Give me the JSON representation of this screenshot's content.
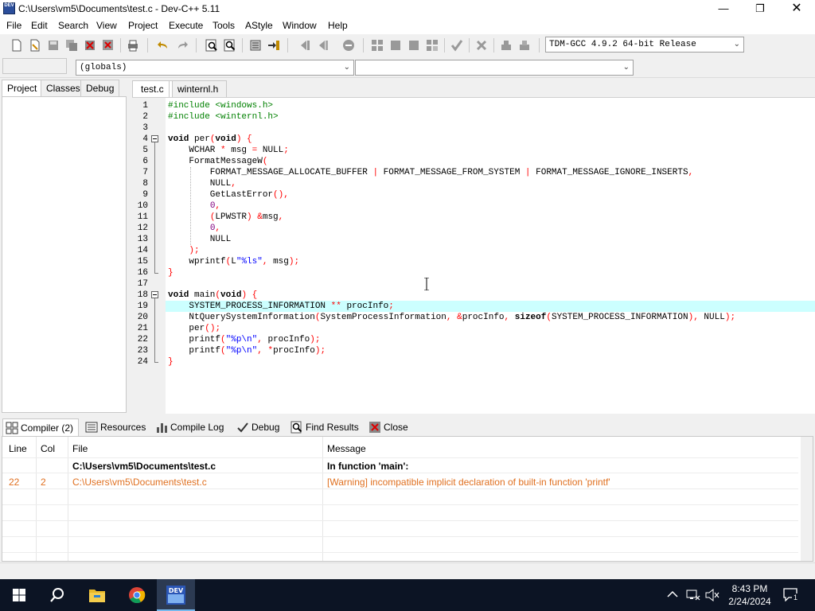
{
  "window": {
    "title": "C:\\Users\\vm5\\Documents\\test.c - Dev-C++ 5.11",
    "app_icon_text": "DEV"
  },
  "menu": [
    "File",
    "Edit",
    "Search",
    "View",
    "Project",
    "Execute",
    "Tools",
    "AStyle",
    "Window",
    "Help"
  ],
  "toolbar": {
    "compiler": "TDM-GCC 4.9.2 64-bit Release",
    "scope": "(globals)",
    "function": ""
  },
  "left_panel": {
    "tabs": [
      "Project",
      "Classes",
      "Debug"
    ],
    "active": "Project"
  },
  "editor": {
    "tabs": [
      "test.c",
      "winternl.h"
    ],
    "active_tab": "test.c",
    "highlight_line": 19,
    "lines": [
      {
        "n": "1",
        "t": "#include <windows.h>"
      },
      {
        "n": "2",
        "t": "#include <winternl.h>"
      },
      {
        "n": "3",
        "t": ""
      },
      {
        "n": "4",
        "t": "void per(void) {"
      },
      {
        "n": "5",
        "t": "    WCHAR * msg = NULL;"
      },
      {
        "n": "6",
        "t": "    FormatMessageW("
      },
      {
        "n": "7",
        "t": "        FORMAT_MESSAGE_ALLOCATE_BUFFER | FORMAT_MESSAGE_FROM_SYSTEM | FORMAT_MESSAGE_IGNORE_INSERTS,"
      },
      {
        "n": "8",
        "t": "        NULL,"
      },
      {
        "n": "9",
        "t": "        GetLastError(),"
      },
      {
        "n": "10",
        "t": "        0,"
      },
      {
        "n": "11",
        "t": "        (LPWSTR) &msg,"
      },
      {
        "n": "12",
        "t": "        0,"
      },
      {
        "n": "13",
        "t": "        NULL"
      },
      {
        "n": "14",
        "t": "    );"
      },
      {
        "n": "15",
        "t": "    wprintf(L\"%ls\", msg);"
      },
      {
        "n": "16",
        "t": "}"
      },
      {
        "n": "17",
        "t": ""
      },
      {
        "n": "18",
        "t": "void main(void) {"
      },
      {
        "n": "19",
        "t": "    SYSTEM_PROCESS_INFORMATION ** procInfo;"
      },
      {
        "n": "20",
        "t": "    NtQuerySystemInformation(SystemProcessInformation, &procInfo, sizeof(SYSTEM_PROCESS_INFORMATION), NULL);"
      },
      {
        "n": "21",
        "t": "    per();"
      },
      {
        "n": "22",
        "t": "    printf(\"%p\\n\", procInfo);"
      },
      {
        "n": "23",
        "t": "    printf(\"%p\\n\", *procInfo);"
      },
      {
        "n": "24",
        "t": "}"
      }
    ]
  },
  "bottom_tabs": [
    {
      "label": "Compiler (2)",
      "icon": "compiler-icon"
    },
    {
      "label": "Resources",
      "icon": "resources-icon"
    },
    {
      "label": "Compile Log",
      "icon": "chart-icon"
    },
    {
      "label": "Debug",
      "icon": "check-icon"
    },
    {
      "label": "Find Results",
      "icon": "find-icon"
    },
    {
      "label": "Close",
      "icon": "close-icon"
    }
  ],
  "messages": {
    "columns": [
      "Line",
      "Col",
      "File",
      "Message"
    ],
    "rows": [
      {
        "line": "",
        "col": "",
        "file": "C:\\Users\\vm5\\Documents\\test.c",
        "message": "In function 'main':",
        "bold": true,
        "color": "#000000"
      },
      {
        "line": "22",
        "col": "2",
        "file": "C:\\Users\\vm5\\Documents\\test.c",
        "message": "[Warning] incompatible implicit declaration of built-in function 'printf'",
        "bold": false,
        "color": "#e07020"
      }
    ]
  },
  "taskbar": {
    "time": "8:43 PM",
    "date": "2/24/2024",
    "notification_count": "1",
    "apps": [
      "windows-start-icon",
      "search-icon",
      "file-explorer-icon",
      "chrome-icon",
      "devcpp-icon"
    ]
  },
  "colors": {
    "highlight_line": "#ccffff",
    "warning": "#e07020",
    "taskbar": "#0c1424"
  }
}
